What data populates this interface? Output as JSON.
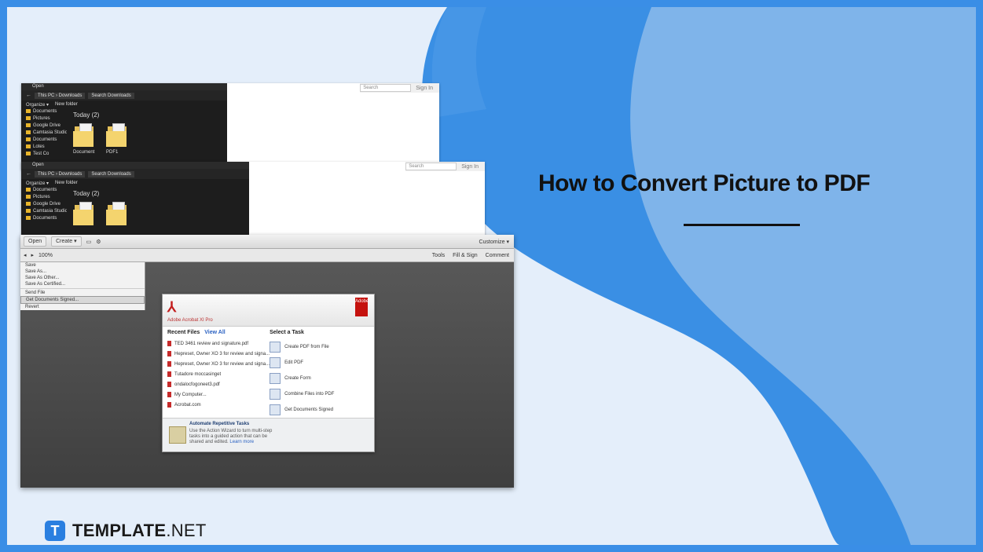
{
  "headline": "How to Convert Picture to PDF",
  "brand": {
    "icon_letter": "T",
    "name": "TEMPLATE",
    "tld": ".NET"
  },
  "explorer1": {
    "title": "Open",
    "address": "This PC › Downloads",
    "search": "Search Downloads",
    "commands": [
      "Organize ▾",
      "New folder"
    ],
    "nav": [
      "Documents",
      "Pictures",
      "Google Drive",
      "Camtasia Studio",
      "Documents",
      "Lotes",
      "Test Co"
    ],
    "group": "Today (2)",
    "files": [
      "Document",
      "PDF1"
    ],
    "right_search": "Search",
    "sign_in": "Sign In"
  },
  "explorer2": {
    "title": "Open",
    "address": "This PC › Downloads",
    "search": "Search Downloads",
    "commands": [
      "Organize ▾",
      "New folder"
    ],
    "nav": [
      "Documents",
      "Pictures",
      "Google Drive",
      "Camtasia Studio",
      "Documents"
    ],
    "group": "Today (2)",
    "right_search": "Search",
    "sign_in": "Sign In"
  },
  "acrobat": {
    "toolbar": {
      "open": "Open",
      "create": "Create ▾",
      "customize": "Customize ▾"
    },
    "toolbar2": {
      "zoom": "100%",
      "tools": "Tools",
      "fill_sign": "Fill & Sign",
      "comment": "Comment"
    },
    "menu": [
      "Save",
      "Save As...",
      "Save As Other...",
      "Save As Certified...",
      "Send File",
      "Get Documents Signed...",
      "Revert"
    ],
    "welcome": {
      "logo": "⅄",
      "product": "Adobe Acrobat XI Pro",
      "badge": "Adobe",
      "recent_title": "Recent Files",
      "view_all": "View All",
      "recent_files": [
        "TED 3461 review and signature.pdf",
        "Hepreset, Owner XO 3 for review and signa...",
        "Hepreset, Owner XO 3 for review and signa...",
        "Tutadore moccasinget",
        "ondalocfogoneet3.pdf",
        "My Computer...",
        "Acrobat.com"
      ],
      "task_title": "Select a Task",
      "tasks": [
        "Create PDF from File",
        "Edit PDF",
        "Create Form",
        "Combine Files into PDF",
        "Get Documents Signed"
      ],
      "footer_title": "Automate Repetitive Tasks",
      "footer_text": "Use the Action Wizard to turn multi-step tasks into a guided action that can be shared and edited.",
      "footer_link": "Learn more"
    }
  },
  "colors": {
    "brand_blue": "#2a7fe0",
    "frame_blue": "#3a8ee6",
    "acrobat_red": "#c5120e"
  }
}
